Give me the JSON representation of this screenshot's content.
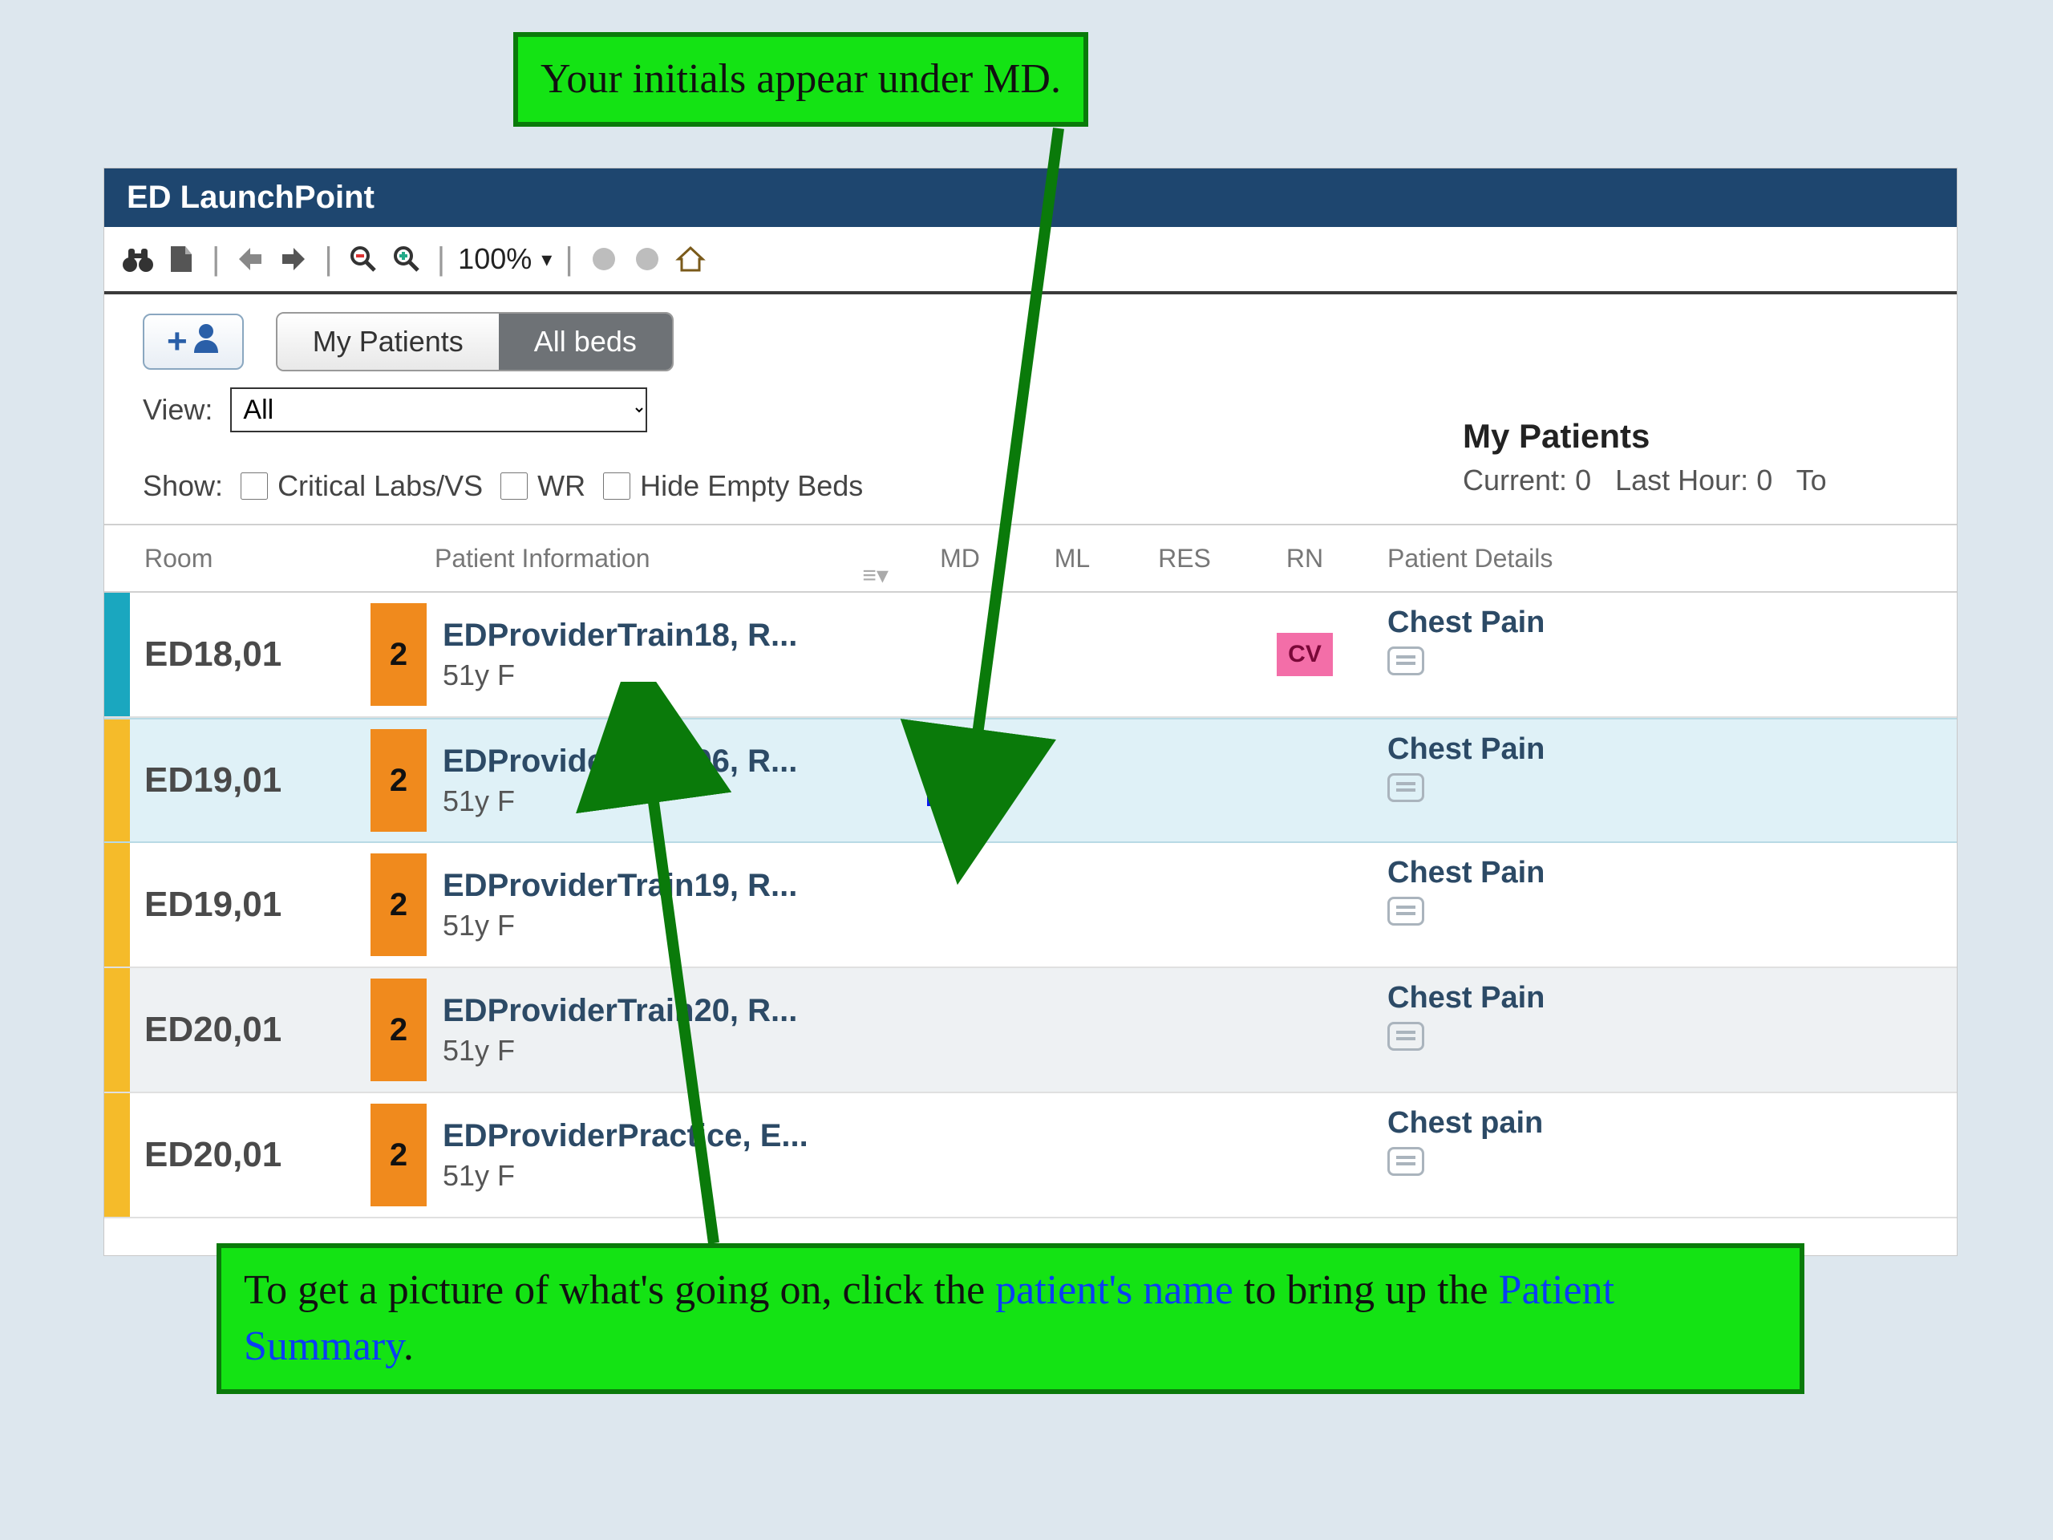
{
  "callouts": {
    "top": "Your initials appear under MD.",
    "bottom_prefix": "To get a picture of what's going on, click the ",
    "bottom_link1": "patient's name",
    "bottom_mid": " to bring up the ",
    "bottom_link2": "Patient Summary",
    "bottom_suffix": "."
  },
  "window": {
    "title": "ED LaunchPoint",
    "zoom": "100%"
  },
  "tabs": {
    "my_patients": "My Patients",
    "all_beds": "All beds"
  },
  "filters": {
    "view_label": "View:",
    "view_value": "All",
    "show_label": "Show:",
    "cb_critical": "Critical Labs/VS",
    "cb_wr": "WR",
    "cb_hide": "Hide Empty Beds"
  },
  "summary": {
    "title": "My Patients",
    "current_label": "Current:",
    "current_val": "0",
    "last_label": "Last Hour:",
    "last_val": "0",
    "to": "To"
  },
  "headers": {
    "room": "Room",
    "pinfo": "Patient Information",
    "md": "MD",
    "ml": "ML",
    "res": "RES",
    "rn": "RN",
    "details": "Patient Details"
  },
  "rows": [
    {
      "room": "ED18,01",
      "pri": "2",
      "name": "EDProviderTrain18, R...",
      "demo": "51y F",
      "md": "",
      "rn": "CV",
      "diag": "Chest Pain",
      "stripe": "teal",
      "alt": false,
      "hl": false
    },
    {
      "room": "ED19,01",
      "pri": "2",
      "name": "EDProviderTrain06, R...",
      "demo": "51y F",
      "md": "QP",
      "rn": "",
      "diag": "Chest Pain",
      "stripe": "yellow",
      "alt": false,
      "hl": true
    },
    {
      "room": "ED19,01",
      "pri": "2",
      "name": "EDProviderTrain19, R...",
      "demo": "51y F",
      "md": "",
      "rn": "",
      "diag": "Chest Pain",
      "stripe": "yellow",
      "alt": false,
      "hl": false
    },
    {
      "room": "ED20,01",
      "pri": "2",
      "name": "EDProviderTrain20, R...",
      "demo": "51y F",
      "md": "",
      "rn": "",
      "diag": "Chest Pain",
      "stripe": "yellow",
      "alt": true,
      "hl": false
    },
    {
      "room": "ED20,01",
      "pri": "2",
      "name": "EDProviderPractice, E...",
      "demo": "51y F",
      "md": "",
      "rn": "",
      "diag": "Chest pain",
      "stripe": "yellow",
      "alt": false,
      "hl": false
    }
  ]
}
